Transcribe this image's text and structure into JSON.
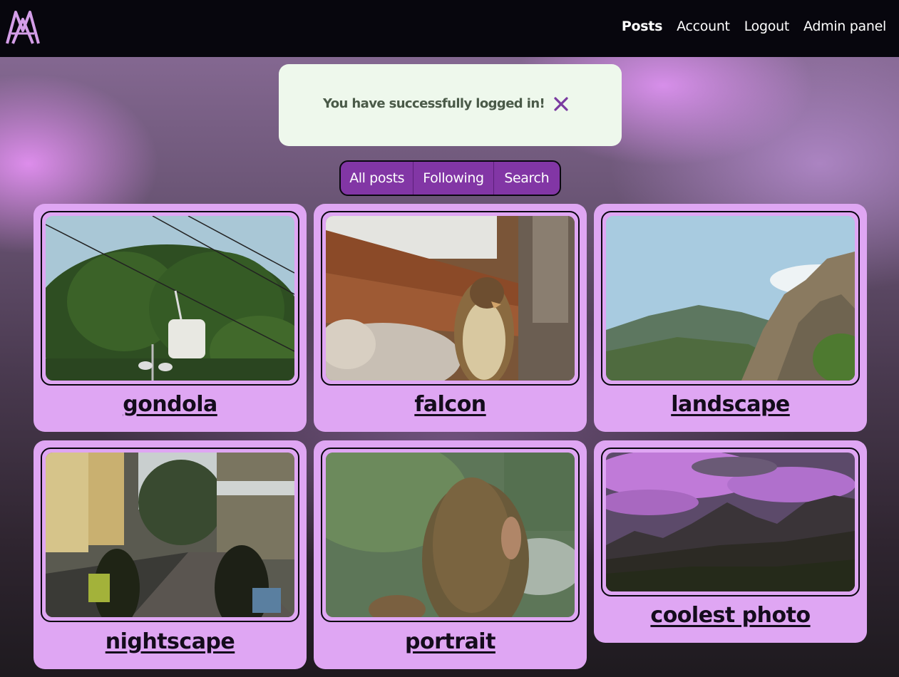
{
  "header": {
    "logo_icon": "double-a-mountain-logo-icon",
    "nav": [
      {
        "label": "Posts",
        "active": true
      },
      {
        "label": "Account",
        "active": false
      },
      {
        "label": "Logout",
        "active": false
      },
      {
        "label": "Admin panel",
        "active": false
      }
    ]
  },
  "alert": {
    "message": "You have successfully logged in!",
    "close_icon": "close-icon"
  },
  "tabs": [
    {
      "label": "All posts"
    },
    {
      "label": "Following"
    },
    {
      "label": "Search"
    }
  ],
  "posts": [
    {
      "title": "gondola"
    },
    {
      "title": "falcon"
    },
    {
      "title": "landscape"
    },
    {
      "title": "nightscape"
    },
    {
      "title": "portrait"
    },
    {
      "title": "coolest photo"
    }
  ],
  "colors": {
    "header_bg": "#07060d",
    "card_bg": "#dfa6f3",
    "tab_bg": "#8236a5",
    "alert_bg": "#eef8ec",
    "close_icon": "#7a3ba0"
  }
}
